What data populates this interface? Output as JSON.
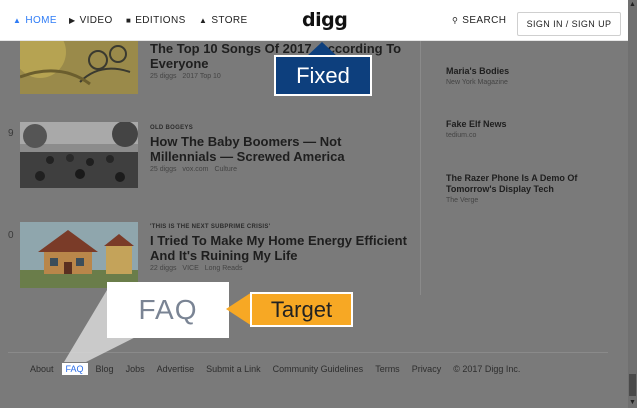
{
  "nav": {
    "items": [
      {
        "label": "HOME",
        "icon": "home-icon",
        "active": true
      },
      {
        "label": "VIDEO",
        "icon": "play-icon",
        "active": false
      },
      {
        "label": "EDITIONS",
        "icon": "editions-icon",
        "active": false
      },
      {
        "label": "STORE",
        "icon": "store-icon",
        "active": false
      }
    ],
    "logo": "digg",
    "search_label": "SEARCH",
    "signin_label": "SIGN IN / SIGN UP"
  },
  "stories": [
    {
      "rank": "",
      "kicker": "",
      "headline": "The Top 10 Songs Of 2017, According To Everyone",
      "meta": [
        "25 diggs",
        "2017 Top 10"
      ]
    },
    {
      "rank": "9",
      "kicker": "OLD BOGEYS",
      "headline": "How The Baby Boomers — Not Millennials — Screwed America",
      "meta": [
        "25 diggs",
        "vox.com",
        "Culture"
      ]
    },
    {
      "rank": "0",
      "kicker": "'THIS IS THE NEXT SUBPRIME CRISIS'",
      "headline": "I Tried To Make My Home Energy Efficient And It's Ruining My Life",
      "meta": [
        "22 diggs",
        "VICE",
        "Long Reads"
      ]
    }
  ],
  "sidebar": [
    {
      "title": "Maria's Bodies",
      "source": "New York Magazine"
    },
    {
      "title": "Fake Elf News",
      "source": "tedium.co"
    },
    {
      "title": "The Razer Phone Is A Demo Of Tomorrow's Display Tech",
      "source": "The Verge"
    }
  ],
  "footer": {
    "links": [
      "About",
      "FAQ",
      "Blog",
      "Jobs",
      "Advertise",
      "Submit a Link",
      "Community Guidelines",
      "Terms",
      "Privacy"
    ],
    "copyright": "© 2017 Digg Inc."
  },
  "annotations": {
    "fixed_label": "Fixed",
    "zoom_text": "FAQ",
    "target_label": "Target"
  },
  "colors": {
    "accent": "#2f7cf6",
    "fixed_bg": "#0d3f7d",
    "target_bg": "#f7a824"
  }
}
